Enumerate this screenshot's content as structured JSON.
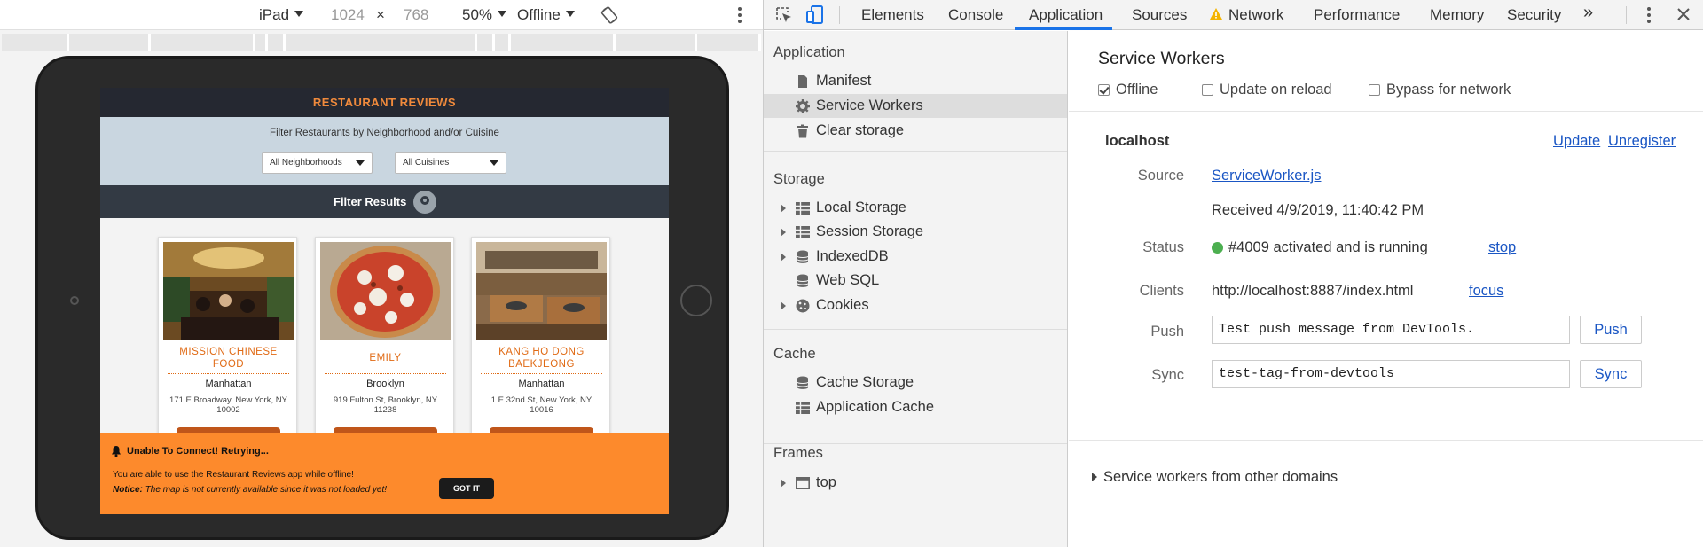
{
  "device_toolbar": {
    "device": "iPad",
    "width": "1024",
    "times": "×",
    "height": "768",
    "zoom": "50%",
    "throttle": "Offline"
  },
  "app": {
    "header": "RESTAURANT REVIEWS",
    "filter_label": "Filter Restaurants by Neighborhood and/or Cuisine",
    "neighborhood_select": "All Neighborhoods",
    "cuisine_select": "All Cuisines",
    "filter_results": "Filter Results",
    "cards": [
      {
        "name": "MISSION CHINESE FOOD",
        "neighborhood": "Manhattan",
        "address": "171 E Broadway, New York, NY 10002"
      },
      {
        "name": "EMILY",
        "neighborhood": "Brooklyn",
        "address": "919 Fulton St, Brooklyn, NY 11238"
      },
      {
        "name": "KANG HO DONG BAEKJEONG",
        "neighborhood": "Manhattan",
        "address": "1 E 32nd St, New York, NY 10016"
      }
    ],
    "toast": {
      "title": "Unable To Connect! Retrying...",
      "message": "You are able to use the Restaurant Reviews app while offline!",
      "notice_label": "Notice:",
      "notice_text": "The map is not currently available since it was not loaded yet!",
      "button": "GOT IT"
    }
  },
  "devtools": {
    "tabs": [
      "Elements",
      "Console",
      "Application",
      "Sources",
      "Network",
      "Performance",
      "Memory",
      "Security"
    ],
    "active_tab": "Application",
    "more": "»",
    "sidebar": {
      "application_header": "Application",
      "application_items": [
        "Manifest",
        "Service Workers",
        "Clear storage"
      ],
      "storage_header": "Storage",
      "storage_items": [
        "Local Storage",
        "Session Storage",
        "IndexedDB",
        "Web SQL",
        "Cookies"
      ],
      "cache_header": "Cache",
      "cache_items": [
        "Cache Storage",
        "Application Cache"
      ],
      "frames_header": "Frames",
      "frames_items": [
        "top"
      ]
    },
    "main": {
      "title": "Service Workers",
      "offline_label": "Offline",
      "offline_checked": true,
      "update_on_reload_label": "Update on reload",
      "bypass_label": "Bypass for network",
      "origin": "localhost",
      "update_link": "Update",
      "unregister_link": "Unregister",
      "source_key": "Source",
      "source_value": "ServiceWorker.js",
      "received": "Received 4/9/2019, 11:40:42 PM",
      "status_key": "Status",
      "status_value": "#4009 activated and is running",
      "status_link": "stop",
      "clients_key": "Clients",
      "clients_value": "http://localhost:8887/index.html",
      "clients_link": "focus",
      "push_key": "Push",
      "push_value": "Test push message from DevTools.",
      "push_button": "Push",
      "sync_key": "Sync",
      "sync_value": "test-tag-from-devtools",
      "sync_button": "Sync",
      "other_domains": "Service workers from other domains"
    },
    "colors": {
      "accent": "#1a73e8",
      "link": "#1a56c4",
      "status_green": "#4caf50",
      "toast_orange": "#fd8a2c"
    }
  }
}
